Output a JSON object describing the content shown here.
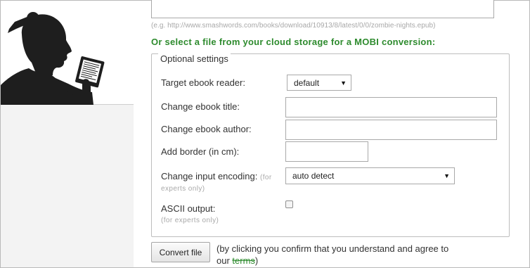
{
  "colors": {
    "accent_green": "#2e8b2e",
    "hint_gray": "#a8a8a8",
    "sidebar_bg": "#f3f3f3"
  },
  "sidebar": {
    "logo_icon": "woman-reading-ebook-silhouette"
  },
  "url_input": {
    "value": "",
    "example": "(e.g. http://www.smashwords.com/books/download/10913/8/latest/0/0/zombie-nights.epub)"
  },
  "cloud_heading": "Or select a file from your cloud storage for a MOBI conversion:",
  "optional_settings": {
    "legend": "Optional settings",
    "target_reader": {
      "label": "Target ebook reader:",
      "selected": "default"
    },
    "title": {
      "label": "Change ebook title:",
      "value": ""
    },
    "author": {
      "label": "Change ebook author:",
      "value": ""
    },
    "border": {
      "label": "Add border (in cm):",
      "value": ""
    },
    "encoding": {
      "label": "Change input encoding:",
      "note_inline": "(for",
      "note_cont": "experts only)",
      "selected": "auto detect"
    },
    "ascii": {
      "label": "ASCII output:",
      "note": "(for experts only)",
      "checked": false
    }
  },
  "convert_button": {
    "label": "Convert file"
  },
  "agree": {
    "text_before": "(by clicking you confirm that you understand and agree to our ",
    "terms": "terms",
    "text_after": ")"
  }
}
